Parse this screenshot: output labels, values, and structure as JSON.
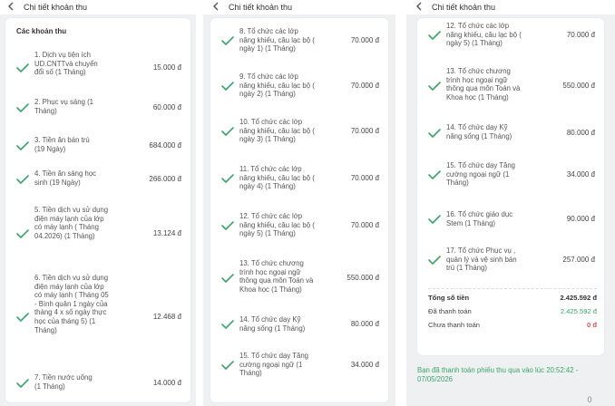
{
  "colors": {
    "accent": "#3aa56a",
    "text": "#333333",
    "danger": "#d9534f"
  },
  "icons": {
    "back": "chevron-left-icon",
    "check": "check-icon"
  },
  "panel1": {
    "header_title": "Chi tiết khoản thu",
    "section_title": "Các khoản thu",
    "items": [
      {
        "label": "1. Dịch vụ tiện ích UD.CNTTvà chuyển đổi số (1 Tháng)",
        "amount": "15.000 đ"
      },
      {
        "label": "2. Phục vụ sáng (1 Tháng)",
        "amount": "60.000 đ"
      },
      {
        "label": "3. Tiền ăn bán trú (19 Ngày)",
        "amount": "684.000 đ"
      },
      {
        "label": "4. Tiền ăn sáng học sinh (19 Ngày)",
        "amount": "266.000 đ"
      },
      {
        "label": "5. Tiền dịch vụ sử dụng điện máy lạnh của lớp có máy lạnh ( Tháng 04.2026) (1 Tháng)",
        "amount": "13.124 đ"
      },
      {
        "label": "6. Tiền dịch vụ sử dụng điện máy lạnh của lớp có máy lạnh ( Tháng 05 - Bình quân 1 ngày của tháng 4 x số ngày thực học của tháng 5) (1 Tháng)",
        "amount": "12.468 đ"
      },
      {
        "label": "7. Tiền nước uống (1 Tháng)",
        "amount": "14.000 đ"
      }
    ]
  },
  "panel2": {
    "header_title": "Chi tiết khoản thu",
    "items": [
      {
        "label": "8. Tổ chức các lớp năng khiếu, câu lạc bộ ( ngày 1) (1 Tháng)",
        "amount": "70.000 đ"
      },
      {
        "label": "9. Tổ chức các lớp năng khiếu, câu lạc bộ ( ngày 2) (1 Tháng)",
        "amount": "70.000 đ"
      },
      {
        "label": "10. Tổ chức các lớp năng khiếu, câu lạc bộ ( ngày 3) (1 Tháng)",
        "amount": "70.000 đ"
      },
      {
        "label": "11. Tổ chức các lớp năng khiếu, câu lạc bộ ( ngày 4) (1 Tháng)",
        "amount": "70.000 đ"
      },
      {
        "label": "12. Tổ chức các lớp năng khiếu, câu lạc bộ ( ngày 5) (1 Tháng)",
        "amount": "70.000 đ"
      },
      {
        "label": "13. Tổ chức chương trình học ngoại ngữ thông qua môn Toán và Khoa học (1 Tháng)",
        "amount": "550.000 đ"
      },
      {
        "label": "14. Tổ chức dạy Kỹ năng sống (1 Tháng)",
        "amount": "80.000 đ"
      },
      {
        "label": "15. Tổ chức dạy Tăng cường ngoại ngữ (1 Tháng)",
        "amount": "34.000 đ"
      }
    ]
  },
  "panel3": {
    "header_title": "Chi tiết khoản thu",
    "items": [
      {
        "label": "12. Tổ chức các lớp năng khiếu, câu lạc bộ ( ngày 5) (1 Tháng)",
        "amount": "70.000 đ"
      },
      {
        "label": "13. Tổ chức chương trình học ngoại ngữ thông qua môn Toán và Khoa học (1 Tháng)",
        "amount": "550.000 đ"
      },
      {
        "label": "14. Tổ chức dạy Kỹ năng sống (1 Tháng)",
        "amount": "80.000 đ"
      },
      {
        "label": "15. Tổ chức dạy Tăng cường ngoại ngữ (1 Tháng)",
        "amount": "34.000 đ"
      },
      {
        "label": "16. Tổ chức giáo dục Stem (1 Tháng)",
        "amount": "90.000 đ"
      },
      {
        "label": "17. Tổ chức Phục vụ , quản lý và vệ sinh bán trú (1 Tháng)",
        "amount": "257.000 đ"
      }
    ],
    "totals": {
      "total_label": "Tổng số tiền",
      "total_value": "2.425.592 đ",
      "paid_label": "Đã thanh toán",
      "paid_value": "2.425.592 đ",
      "unpaid_label": "Chưa thanh toán",
      "unpaid_value": "0 đ"
    },
    "paid_note": "Bạn đã thanh toán phiếu thu qua vào lúc 20:52:42 - 07/05/2026"
  },
  "scroll_indicator": "0"
}
